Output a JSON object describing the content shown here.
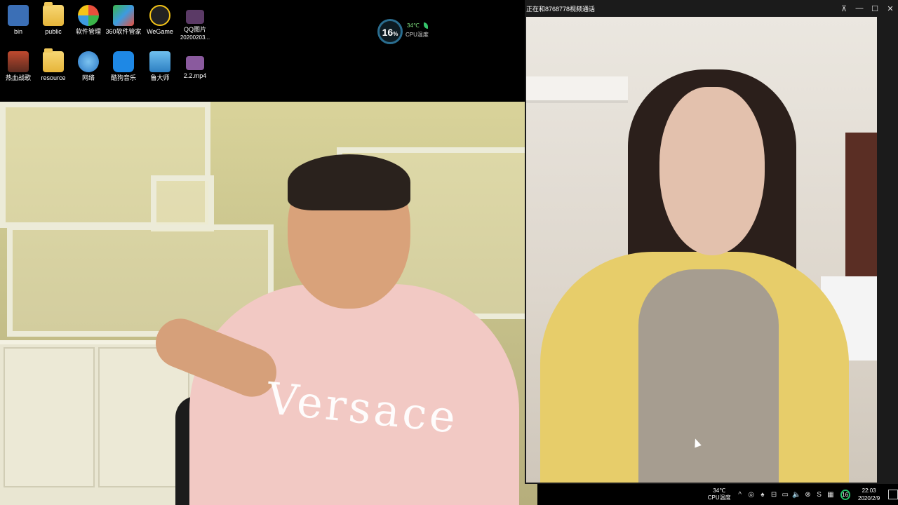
{
  "desktop": {
    "icons": [
      {
        "label": "bin",
        "label2": "",
        "icon": "bin-app-icon",
        "color": "#3b6fb6"
      },
      {
        "label": "public",
        "label2": "",
        "icon": "folder-icon",
        "color": "#f0c85a"
      },
      {
        "label": "软件管理",
        "label2": "",
        "icon": "software-manager-icon",
        "color": "#e84f3c"
      },
      {
        "label": "360软件管家",
        "label2": "",
        "icon": "360-icon",
        "color": "#3bb54a"
      },
      {
        "label": "WeGame",
        "label2": "",
        "icon": "wegame-icon",
        "color": "#f5c518"
      },
      {
        "label": "QQ图片",
        "label2": "20200203...",
        "icon": "image-file-icon",
        "color": "#9a5ca8"
      },
      {
        "label": "热血战歌",
        "label2": "",
        "icon": "game-icon",
        "color": "#c04a2f"
      },
      {
        "label": "resource",
        "label2": "",
        "icon": "folder-icon",
        "color": "#f0c85a"
      },
      {
        "label": "网络",
        "label2": "",
        "icon": "network-icon",
        "color": "#3d9be0"
      },
      {
        "label": "酷狗音乐",
        "label2": "",
        "icon": "kugou-icon",
        "color": "#1e88e5"
      },
      {
        "label": "鲁大师",
        "label2": "",
        "icon": "ludashi-icon",
        "color": "#4aa3df"
      },
      {
        "label": "2.2.mp4",
        "label2": "",
        "icon": "video-file-icon",
        "color": "#8a5a9e"
      }
    ]
  },
  "cpu_widget": {
    "usage": "16",
    "usage_unit": "%",
    "temperature": "34℃",
    "temp_label": "CPU温度"
  },
  "webcam_left": {
    "shirt_text": "Versace"
  },
  "video_call": {
    "title": "正在和8768778视频通话",
    "buttons": {
      "pin": "📌",
      "minimize": "—",
      "maximize": "☐",
      "close": "✕"
    }
  },
  "tray": {
    "temperature": "34℃",
    "temp_label": "CPU温度",
    "badge": "16",
    "time": "22:03",
    "date": "2020/2/9"
  }
}
